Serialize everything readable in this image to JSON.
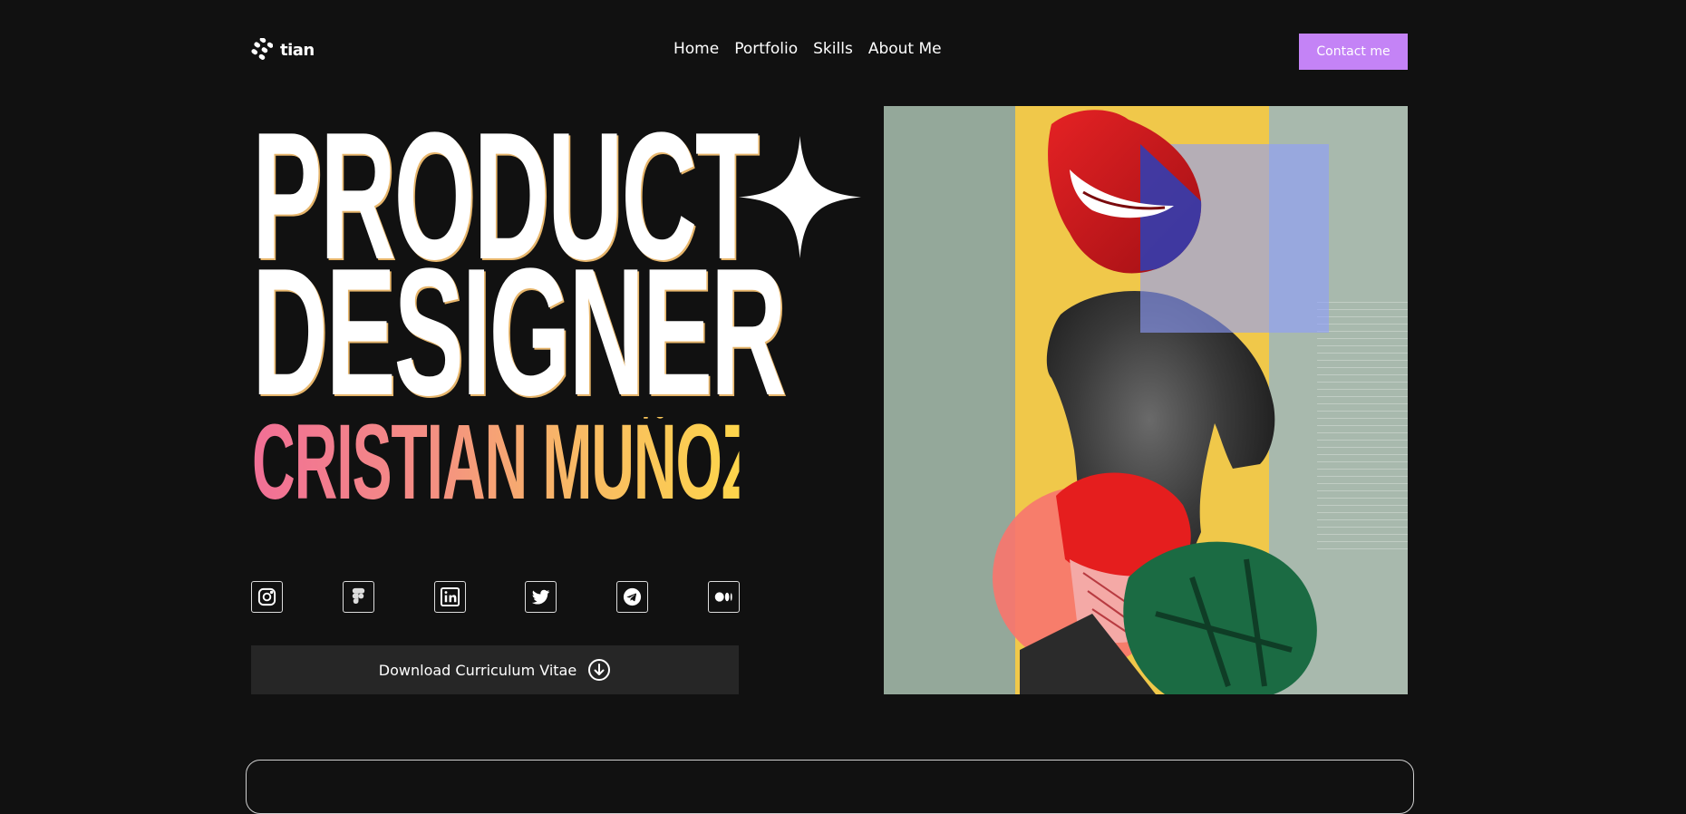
{
  "header": {
    "logo_text": "tian",
    "nav": [
      {
        "label": "Home"
      },
      {
        "label": "Portfolio"
      },
      {
        "label": "Skills"
      },
      {
        "label": "About Me"
      }
    ],
    "contact_label": "Contact me",
    "contact_color": "#c483f6"
  },
  "hero": {
    "title_line1": "PRODUCT",
    "title_line2": "DESIGNER",
    "name": "CRISTIAN MUÑOZ",
    "name_gradient": [
      "#f16f96",
      "#fdd54b"
    ],
    "cv_label": "Download Curriculum Vitae"
  },
  "socials": [
    {
      "icon": "instagram-icon"
    },
    {
      "icon": "figma-icon"
    },
    {
      "icon": "linkedin-icon"
    },
    {
      "icon": "twitter-icon"
    },
    {
      "icon": "telegram-icon"
    },
    {
      "icon": "medium-icon"
    }
  ],
  "colors": {
    "background": "#111111",
    "button_dark": "#262626"
  }
}
